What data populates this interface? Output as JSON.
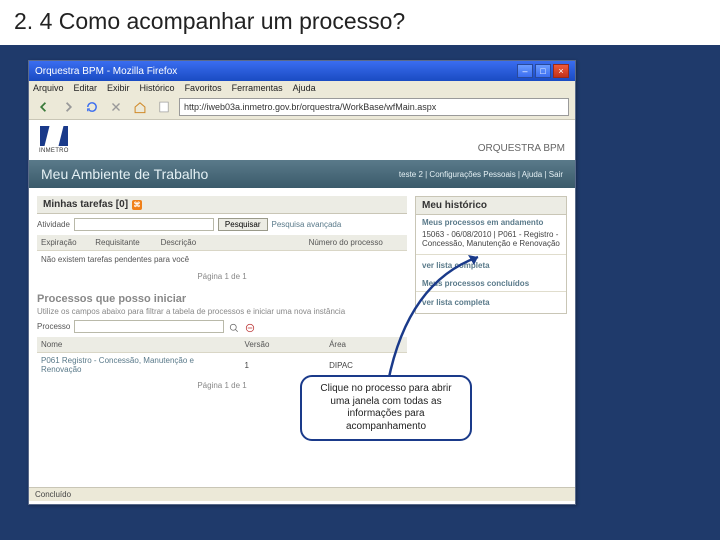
{
  "slide_title": "2. 4  Como acompanhar um processo?",
  "browser": {
    "title": "Orquestra BPM - Mozilla Firefox",
    "menus": [
      "Arquivo",
      "Editar",
      "Exibir",
      "Histórico",
      "Favoritos",
      "Ferramentas",
      "Ajuda"
    ],
    "url": "http://iweb03a.inmetro.gov.br/orquestra/WorkBase/wfMain.aspx",
    "brand_inmetro": "INMETRO",
    "brand_right": "ORQUESTRA BPM",
    "header": "Meu Ambiente de Trabalho",
    "header_links": "teste 2 | Configurações Pessoais | Ajuda | Sair",
    "tasks_title": "Minhas tarefas [0]",
    "filter_label": "Atividade",
    "btn_search": "Pesquisar",
    "link_adv": "Pesquisa avançada",
    "cols": {
      "c1": "Expiração",
      "c2": "Requisitante",
      "c3": "Descrição",
      "c4": "Número do processo"
    },
    "empty": "Não existem tarefas pendentes para você",
    "pager": "Página 1 de 1",
    "start_h": "Processos que posso iniciar",
    "start_hint": "Utilize os campos abaixo para filtrar a tabela de processos e iniciar uma nova instância",
    "proc_label": "Processo",
    "proc_cols": {
      "c1": "Nome",
      "c2": "Versão",
      "c3": "Área"
    },
    "proc_row": {
      "name": "P061  Registro - Concessão, Manutenção e Renovação",
      "ver": "1",
      "area": "DIPAC"
    },
    "hist_h": "Meu histórico",
    "hist_sub": "Meus processos em andamento",
    "hist_item": "15063 - 06/08/2010 | P061 - Registro - Concessão, Manutenção e Renovação",
    "hist_link1": "ver lista completa",
    "hist_sub2": "Meus processos concluídos",
    "hist_link2": "ver lista completa",
    "status": "Concluído"
  },
  "callout": "Clique no processo para abrir uma janela com todas as informações para acompanhamento"
}
